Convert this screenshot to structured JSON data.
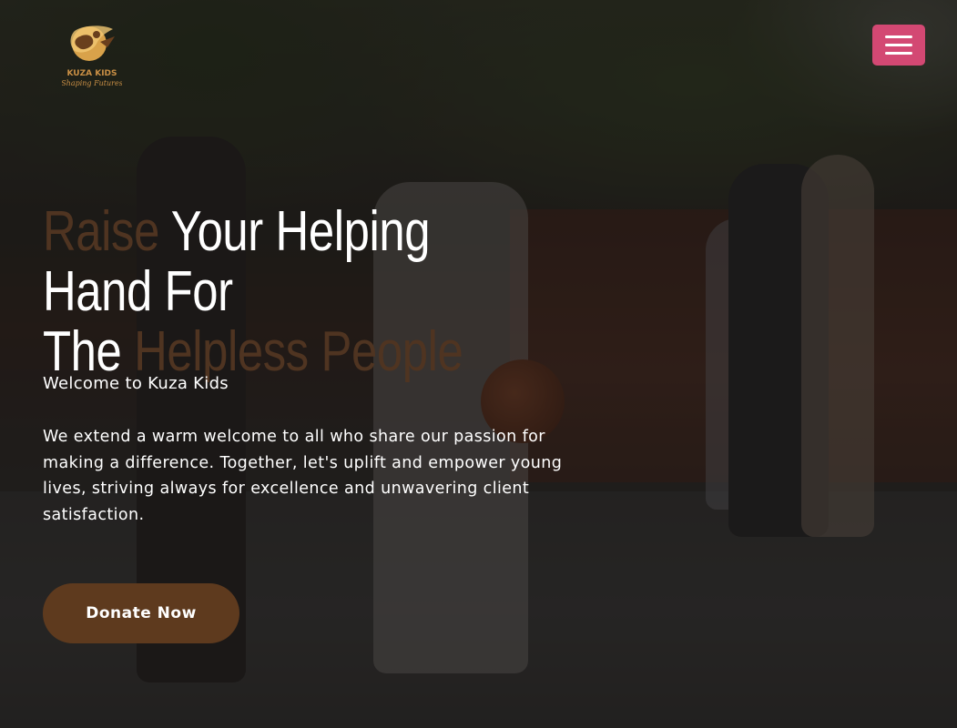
{
  "header": {
    "logo": {
      "brand": "KUZA KIDS",
      "tagline": "Shaping Futures",
      "icon": "kuza-kids-logo-icon"
    },
    "menu_button": {
      "icon": "hamburger-menu-icon"
    }
  },
  "hero": {
    "headline": {
      "part1_accent": "Raise ",
      "part2": "Your Helping Hand For",
      "part3": "The ",
      "part4_accent": "Helpless People"
    },
    "welcome": "Welcome to Kuza Kids",
    "description": "We extend a warm welcome to all who share our passion for making a difference. Together, let's uplift and empower young lives, striving always for excellence and unwavering client satisfaction.",
    "donate_label": "Donate Now"
  },
  "colors": {
    "accent_brown": "#5e3a1e",
    "menu_pink": "#d34873",
    "headline_accent": "#4f3421",
    "text": "#ffffff"
  }
}
